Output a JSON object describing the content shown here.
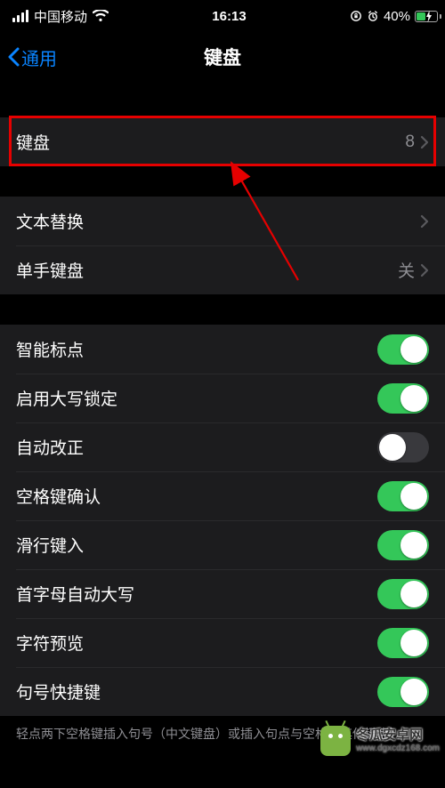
{
  "status": {
    "carrier": "中国移动",
    "time": "16:13",
    "battery_pct": "40%"
  },
  "nav": {
    "back_label": "通用",
    "title": "键盘"
  },
  "groups": {
    "g1": {
      "keyboards_label": "键盘",
      "keyboards_value": "8"
    },
    "g2": {
      "text_replace_label": "文本替换",
      "one_hand_label": "单手键盘",
      "one_hand_value": "关"
    },
    "g3": [
      {
        "label": "智能标点",
        "on": true
      },
      {
        "label": "启用大写锁定",
        "on": true
      },
      {
        "label": "自动改正",
        "on": false
      },
      {
        "label": "空格键确认",
        "on": true
      },
      {
        "label": "滑行键入",
        "on": true
      },
      {
        "label": "首字母自动大写",
        "on": true
      },
      {
        "label": "字符预览",
        "on": true
      },
      {
        "label": "句号快捷键",
        "on": true
      }
    ]
  },
  "footer": "轻点两下空格键插入句号（中文键盘）或插入句点与空格（其他键盘）。",
  "watermark": {
    "line1": "冬瓜安卓网",
    "line2": "www.dgxcdz168.com"
  },
  "annotation": {
    "highlight_target": "keyboards-cell"
  }
}
